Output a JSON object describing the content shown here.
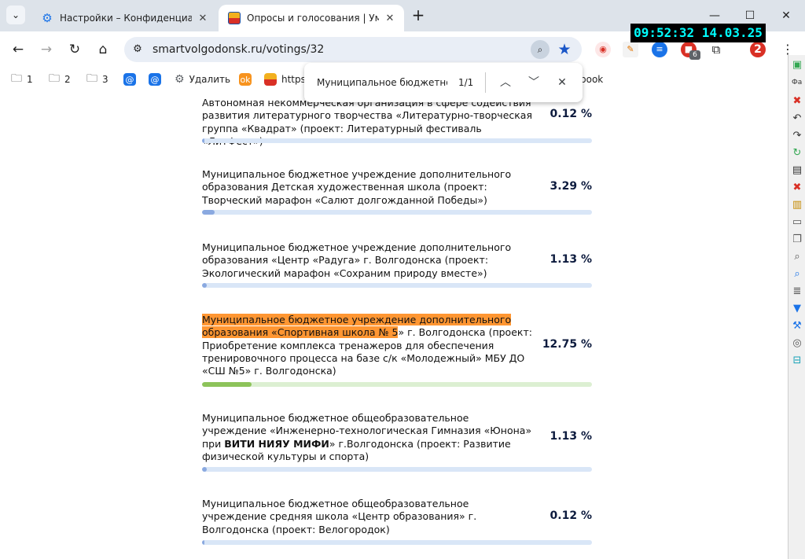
{
  "browser": {
    "tabs": [
      {
        "title": "Настройки – Конфиденциальн",
        "active": false,
        "icon": "gear-icon"
      },
      {
        "title": "Опросы и голосования | Умны",
        "active": true,
        "icon": "city-crest-icon"
      }
    ],
    "clock": "09:52:32 14.03.25",
    "url": "smartvolgodonsk.ru/votings/32",
    "extension_badge": "6",
    "profile_number": "2"
  },
  "bookmarks": [
    {
      "label": "1",
      "icon": "folder-icon"
    },
    {
      "label": "2",
      "icon": "folder-icon"
    },
    {
      "label": "3",
      "icon": "folder-icon"
    },
    {
      "label": "",
      "icon": "at-sign-icon"
    },
    {
      "label": "",
      "icon": "at-sign-icon"
    },
    {
      "label": "Удалить",
      "icon": "gear-icon"
    },
    {
      "label": "",
      "icon": "ok-icon"
    },
    {
      "label": "https:",
      "icon": "city-crest-icon"
    },
    {
      "label": "book",
      "icon": "bookmark-icon"
    }
  ],
  "findbar": {
    "query": "Муниципальное бюджетное учреждение",
    "count": "1/1"
  },
  "sidepanel": {
    "label": "Фа"
  },
  "votes": [
    {
      "name": "Автономная некоммерческая организация в сфере содействия развития литературного творчества «Литературно-творческая группа «Квадрат» (проект: Литературный фестиваль «ЛитФест»)",
      "percent_label": "0.12 %",
      "percent": 0.12
    },
    {
      "name": "Муниципальное бюджетное учреждение дополнительного образования Детская художественная школа (проект: Творческий марафон «Салют долгожданной Победы»)",
      "percent_label": "3.29 %",
      "percent": 3.29
    },
    {
      "name": "Муниципальное бюджетное учреждение дополнительного образования «Центр «Радуга» г. Волгодонска (проект: Экологический марафон «Сохраним природу вместе»)",
      "percent_label": "1.13 %",
      "percent": 1.13
    },
    {
      "name_highlight": "Муниципальное бюджетное учреждение дополнительного образования «Спортивная школа № 5",
      "name_rest": "» г. Волгодонска (проект: Приобретение комплекса тренажеров для обеспечения тренировочного процесса на базе с/к «Молодежный» МБУ ДО «СШ №5» г. Волгодонска)",
      "percent_label": "12.75 %",
      "percent": 12.75
    },
    {
      "name_pre": "Муниципальное бюджетное общеобразовательное учреждение «Инженерно-технологическая Гимназия «Юнона» при ",
      "name_bold": "ВИТИ НИЯУ МИФИ",
      "name_post": "» г.Волгодонска (проект: Развитие физической культуры и спорта)",
      "percent_label": "1.13 %",
      "percent": 1.13
    },
    {
      "name": "Муниципальное бюджетное общеобразовательное учреждение средняя школа «Центр образования» г. Волгодонска (проект: Велогородок)",
      "percent_label": "0.12 %",
      "percent": 0.12
    }
  ]
}
